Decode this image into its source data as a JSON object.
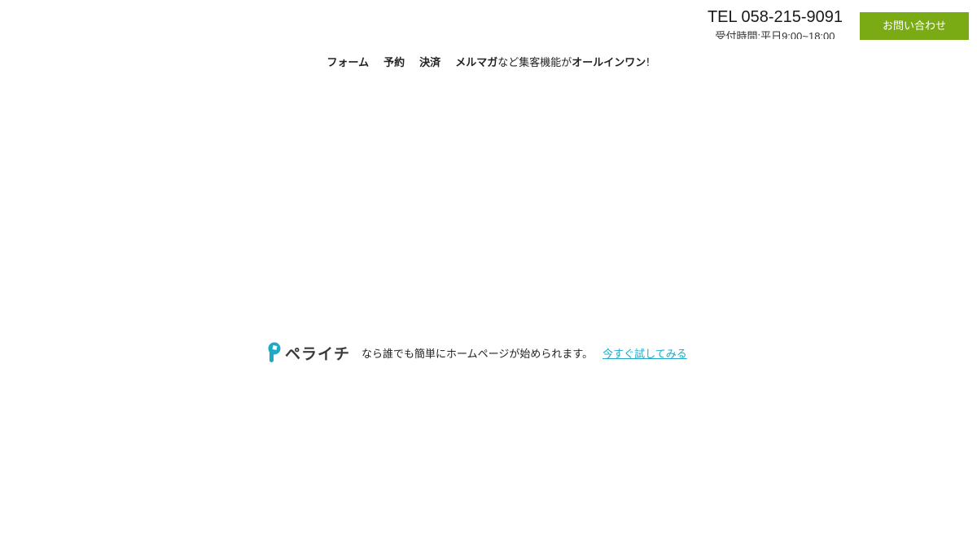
{
  "header": {
    "tel": "TEL 058-215-9091",
    "hours": "受付時間:平日9:00~18:00",
    "contact_button": "お問い合わせ"
  },
  "feature_bar": {
    "form": "フォーム",
    "reserve": "予約",
    "payment": "決済",
    "mailmag": "メルマガ",
    "mid_text": "など集客機能が",
    "allinone": "オールインワン",
    "tail": "!"
  },
  "promo": {
    "brand": "ペライチ",
    "text": "なら誰でも簡単にホームページが始められます。",
    "link": "今すぐ試してみる"
  },
  "colors": {
    "accent_green": "#7aab14",
    "brand_teal": "#1fa9c4"
  }
}
